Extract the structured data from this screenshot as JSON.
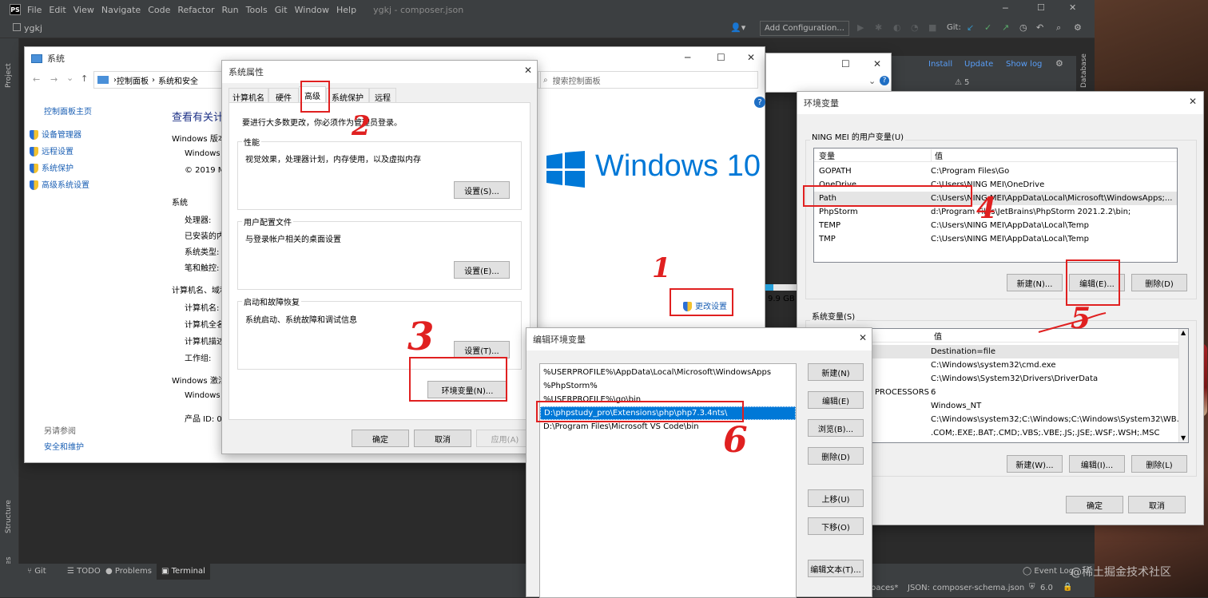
{
  "ide": {
    "logo": "PS",
    "menu": [
      "File",
      "Edit",
      "View",
      "Navigate",
      "Code",
      "Refactor",
      "Run",
      "Tools",
      "Git",
      "Window",
      "Help"
    ],
    "title": "ygkj - composer.json",
    "project": "ygkj",
    "add_config": "Add Configuration...",
    "git_label": "Git:",
    "install": "Install",
    "update": "Update",
    "show_log": "Show log",
    "warn_count": "5",
    "side_project": "Project",
    "side_structure": "Structure",
    "side_favorites": "Favorites",
    "side_database": "Database",
    "bottom_tabs": [
      "Git",
      "TODO",
      "Problems",
      "Terminal"
    ],
    "event_log": "Event Log",
    "status_spaces": "paces*",
    "status_schema": "JSON: composer-schema.json",
    "status_php": "6.0"
  },
  "system": {
    "title": "系统",
    "breadcrumb": [
      "控制面板",
      "系统和安全"
    ],
    "search_placeholder": "搜索控制面板",
    "home_link": "控制面板主页",
    "links": [
      "设备管理器",
      "远程设置",
      "系统保护",
      "高级系统设置"
    ],
    "see_also": "另请参阅",
    "security": "安全和维护",
    "heading": "查看有关计",
    "win_edition": "Windows 版本",
    "win_line": "Windows",
    "copyright": "© 2019 M",
    "sys_section": "系统",
    "sys_items": [
      "处理器:",
      "已安装的内",
      "系统类型:",
      "笔和触控:"
    ],
    "name_section": "计算机名、域和",
    "name_items": [
      "计算机名:",
      "计算机全名",
      "计算机描述",
      "工作组:"
    ],
    "activation": "Windows 激活",
    "act_line": "Windows",
    "product_id": "产品 ID: 0",
    "win10": "Windows 10",
    "change_settings": "更改设置",
    "disk": "9.9 GB"
  },
  "sysprops": {
    "title": "系统属性",
    "tabs": [
      "计算机名",
      "硬件",
      "高级",
      "系统保护",
      "远程"
    ],
    "note": "要进行大多数更改，你必须作为管理员登录。",
    "perf_title": "性能",
    "perf_desc": "视觉效果，处理器计划，内存使用，以及虚拟内存",
    "perf_btn": "设置(S)...",
    "profile_title": "用户配置文件",
    "profile_desc": "与登录帐户相关的桌面设置",
    "profile_btn": "设置(E)...",
    "startup_title": "启动和故障恢复",
    "startup_desc": "系统启动、系统故障和调试信息",
    "startup_btn": "设置(T)...",
    "env_btn": "环境变量(N)...",
    "ok": "确定",
    "cancel": "取消",
    "apply": "应用(A)"
  },
  "envvars": {
    "title": "环境变量",
    "user_group": "NING MEI 的用户变量(U)",
    "col_var": "变量",
    "col_val": "值",
    "user_vars": [
      {
        "name": "GOPATH",
        "value": "C:\\Program Files\\Go"
      },
      {
        "name": "OneDrive",
        "value": "C:\\Users\\NING MEI\\OneDrive"
      },
      {
        "name": "Path",
        "value": "C:\\Users\\NING MEI\\AppData\\Local\\Microsoft\\WindowsApps;..."
      },
      {
        "name": "PhpStorm",
        "value": "d:\\Program Files\\JetBrains\\PhpStorm 2021.2.2\\bin;"
      },
      {
        "name": "TEMP",
        "value": "C:\\Users\\NING MEI\\AppData\\Local\\Temp"
      },
      {
        "name": "TMP",
        "value": "C:\\Users\\NING MEI\\AppData\\Local\\Temp"
      }
    ],
    "new_btn": "新建(N)...",
    "edit_btn": "编辑(E)...",
    "del_btn": "删除(D)",
    "sys_group": "系统变量(S)",
    "sys_vars": [
      {
        "name": "",
        "value": "Destination=file"
      },
      {
        "name": "",
        "value": "C:\\Windows\\system32\\cmd.exe"
      },
      {
        "name": "",
        "value": "C:\\Windows\\System32\\Drivers\\DriverData"
      },
      {
        "name": "PROCESSORS",
        "value": "6"
      },
      {
        "name": "",
        "value": "Windows_NT"
      },
      {
        "name": "",
        "value": "C:\\Windows\\system32;C:\\Windows;C:\\Windows\\System32\\WB..."
      },
      {
        "name": "",
        "value": ".COM;.EXE;.BAT;.CMD;.VBS;.VBE;.JS;.JSE;.WSF;.WSH;.MSC"
      }
    ],
    "sys_new": "新建(W)...",
    "sys_edit": "编辑(I)...",
    "sys_del": "删除(L)",
    "ok": "确定",
    "cancel": "取消"
  },
  "editenv": {
    "title": "编辑环境变量",
    "entries": [
      "%USERPROFILE%\\AppData\\Local\\Microsoft\\WindowsApps",
      "%PhpStorm%",
      "%USERPROFILE%\\go\\bin",
      "D:\\phpstudy_pro\\Extensions\\php\\php7.3.4nts\\",
      "D:\\Program Files\\Microsoft VS Code\\bin"
    ],
    "buttons": [
      "新建(N)",
      "编辑(E)",
      "浏览(B)...",
      "删除(D)",
      "上移(U)",
      "下移(O)",
      "编辑文本(T)..."
    ]
  },
  "annotations": [
    "1",
    "2",
    "3",
    "4",
    "5",
    "6"
  ],
  "ime": "英",
  "watermark": "@稀土掘金技术社区",
  "colors": {
    "accent": "#0078d7",
    "annotation": "#e02020",
    "ide_bg": "#3c3f41",
    "selection": "#0078d7"
  }
}
